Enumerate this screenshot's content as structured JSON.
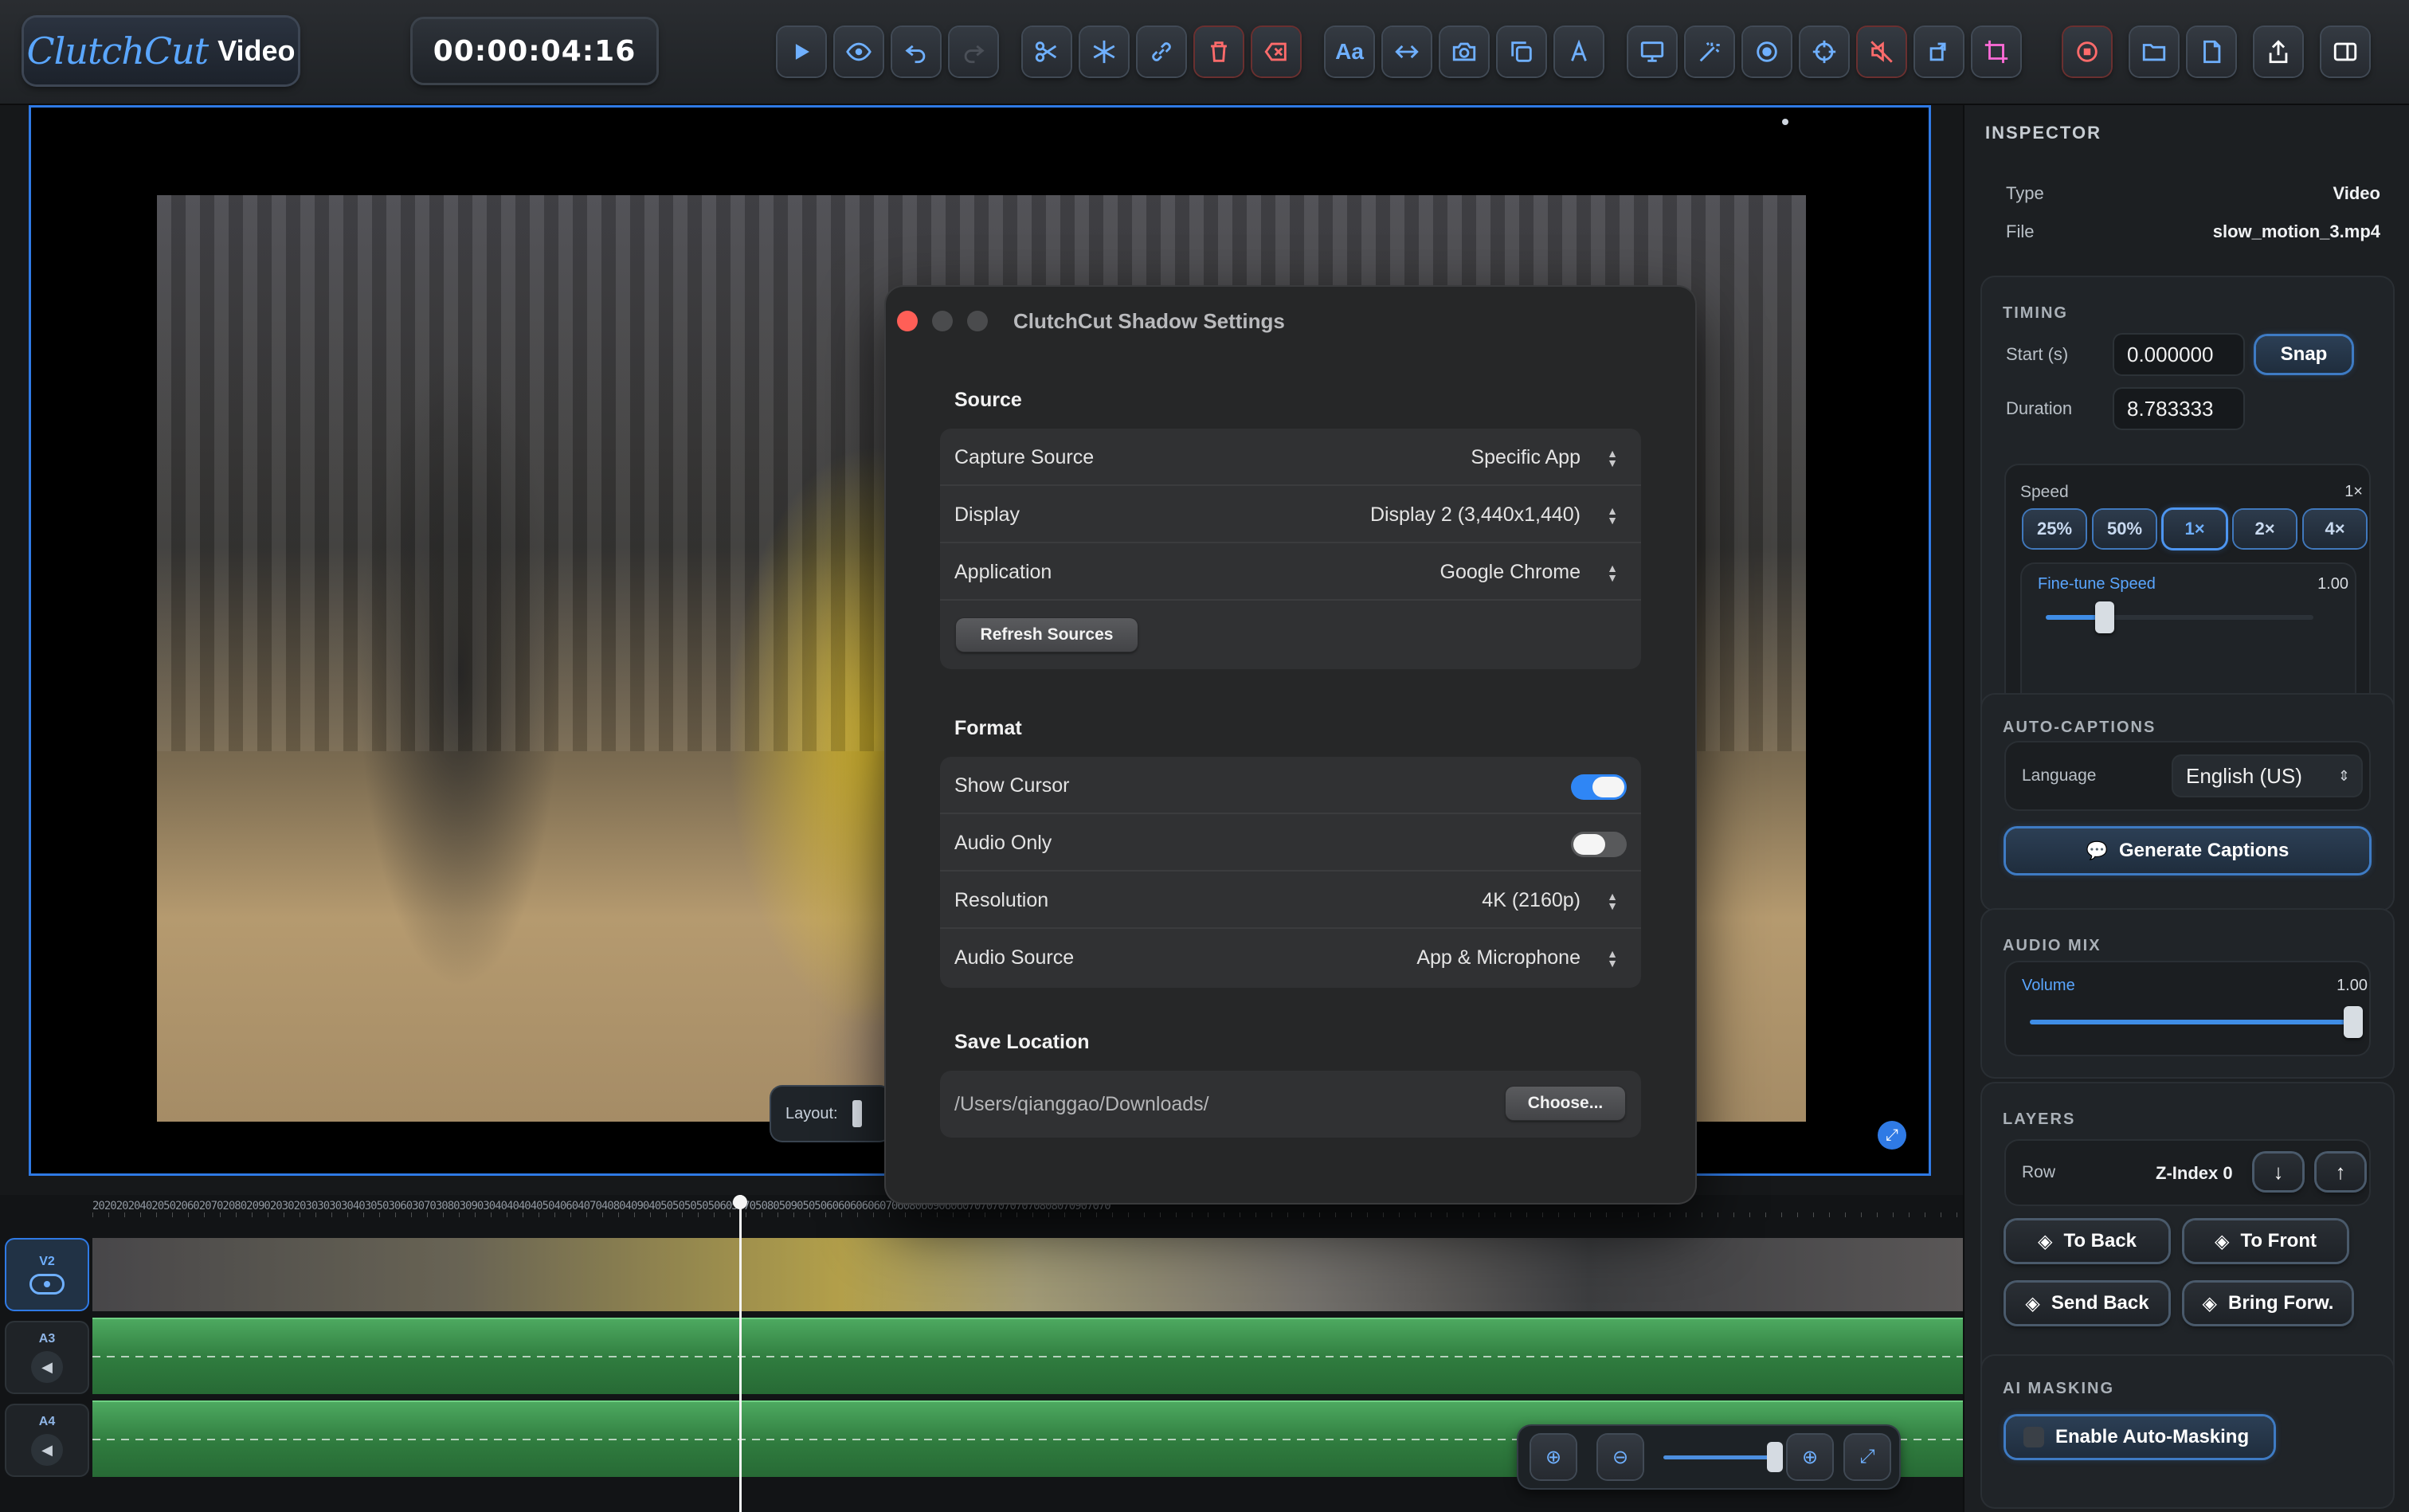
{
  "app": {
    "brand": "ClutchCut",
    "brand_sub": "Video",
    "timecode": "00:00:04:16"
  },
  "toolbar": {
    "buttons": [
      {
        "icon": "play-icon"
      },
      {
        "icon": "eye-icon"
      },
      {
        "icon": "undo-icon"
      },
      {
        "icon": "redo-icon"
      },
      {
        "icon": "scissors-icon"
      },
      {
        "icon": "snowflake-icon"
      },
      {
        "icon": "link-icon"
      },
      {
        "icon": "trash-icon"
      },
      {
        "icon": "delete-gap-icon"
      },
      {
        "icon": "text-icon"
      },
      {
        "icon": "transition-icon"
      },
      {
        "icon": "camera-icon"
      },
      {
        "icon": "duplicate-icon"
      },
      {
        "icon": "pen-icon"
      },
      {
        "icon": "monitor-icon"
      },
      {
        "icon": "magic-wand-icon"
      },
      {
        "icon": "record-icon"
      },
      {
        "icon": "target-icon"
      },
      {
        "icon": "mute-icon"
      },
      {
        "icon": "rotate-icon"
      },
      {
        "icon": "crop-icon"
      },
      {
        "icon": "stop-record-icon"
      },
      {
        "icon": "folder-icon"
      },
      {
        "icon": "document-icon"
      },
      {
        "icon": "export-icon"
      },
      {
        "icon": "sidebar-icon"
      }
    ]
  },
  "preview": {
    "layout_label": "Layout:"
  },
  "timeline": {
    "ruler_text": "2020202040205020602070208020902030203030303040305030603070308030903040404040504060407040804090405050505050605070508050905050606060606070608060906060707070707070808070907070",
    "tracks": [
      {
        "label": "V2",
        "kind": "video"
      },
      {
        "label": "A3",
        "kind": "audio"
      },
      {
        "label": "A4",
        "kind": "audio"
      }
    ]
  },
  "inspector": {
    "title": "INSPECTOR",
    "file_info": {
      "type_label": "Type",
      "type_value": "Video",
      "file_label": "File",
      "file_value": "slow_motion_3.mp4"
    },
    "timing": {
      "title": "TIMING",
      "start_label": "Start (s)",
      "start_value": "0.000000",
      "snap_label": "Snap",
      "duration_label": "Duration",
      "duration_value": "8.783333",
      "speed_label": "Speed",
      "speed_value": "1×",
      "speed_options": [
        "25%",
        "50%",
        "1×",
        "2×",
        "4×"
      ],
      "speed_active": "1×",
      "finetune_label": "Fine-tune Speed",
      "finetune_value": "1.00",
      "finetune_fraction": 0.22
    },
    "auto_captions": {
      "title": "AUTO-CAPTIONS",
      "language_label": "Language",
      "language_value": "English (US)",
      "generate_label": "Generate Captions"
    },
    "audio_mix": {
      "title": "AUDIO MIX",
      "volume_label": "Volume",
      "volume_value": "1.00",
      "volume_fraction": 1.0
    },
    "layers": {
      "title": "LAYERS",
      "row_label": "Row",
      "zindex_label": "Z-Index 0",
      "to_back": "To Back",
      "to_front": "To Front",
      "send_back": "Send Back",
      "bring_forward": "Bring Forw."
    },
    "ai_masking": {
      "title": "AI MASKING",
      "enable_label": "Enable Auto-Masking"
    }
  },
  "dialog": {
    "title": "ClutchCut Shadow Settings",
    "source": {
      "title": "Source",
      "capture_source_label": "Capture Source",
      "capture_source_value": "Specific App",
      "display_label": "Display",
      "display_value": "Display 2 (3,440x1,440)",
      "application_label": "Application",
      "application_value": "Google Chrome",
      "refresh_label": "Refresh Sources"
    },
    "format": {
      "title": "Format",
      "show_cursor_label": "Show Cursor",
      "show_cursor_on": true,
      "audio_only_label": "Audio Only",
      "audio_only_on": false,
      "resolution_label": "Resolution",
      "resolution_value": "4K (2160p)",
      "audio_source_label": "Audio Source",
      "audio_source_value": "App & Microphone"
    },
    "save": {
      "title": "Save Location",
      "path": "/Users/qianggao/Downloads/",
      "choose_label": "Choose..."
    }
  },
  "colors": {
    "accent": "#2f7ae5",
    "toggle_on": "#2f86f5",
    "audio_track": "#3f9a52",
    "close_button": "#ff5f57"
  }
}
